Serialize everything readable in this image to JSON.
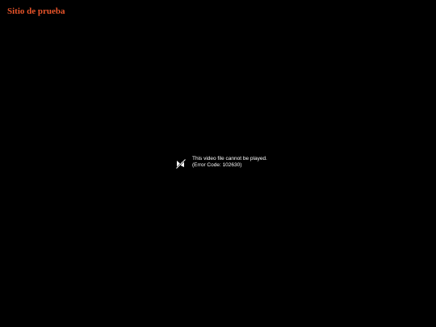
{
  "site": {
    "title": "Sitio de prueba",
    "title_color": "#e8542a"
  },
  "player": {
    "background": "#000000",
    "error": {
      "icon": "broken-video-icon",
      "message": "This video file cannot be played.",
      "code": "(Error Code: 102630)"
    }
  }
}
